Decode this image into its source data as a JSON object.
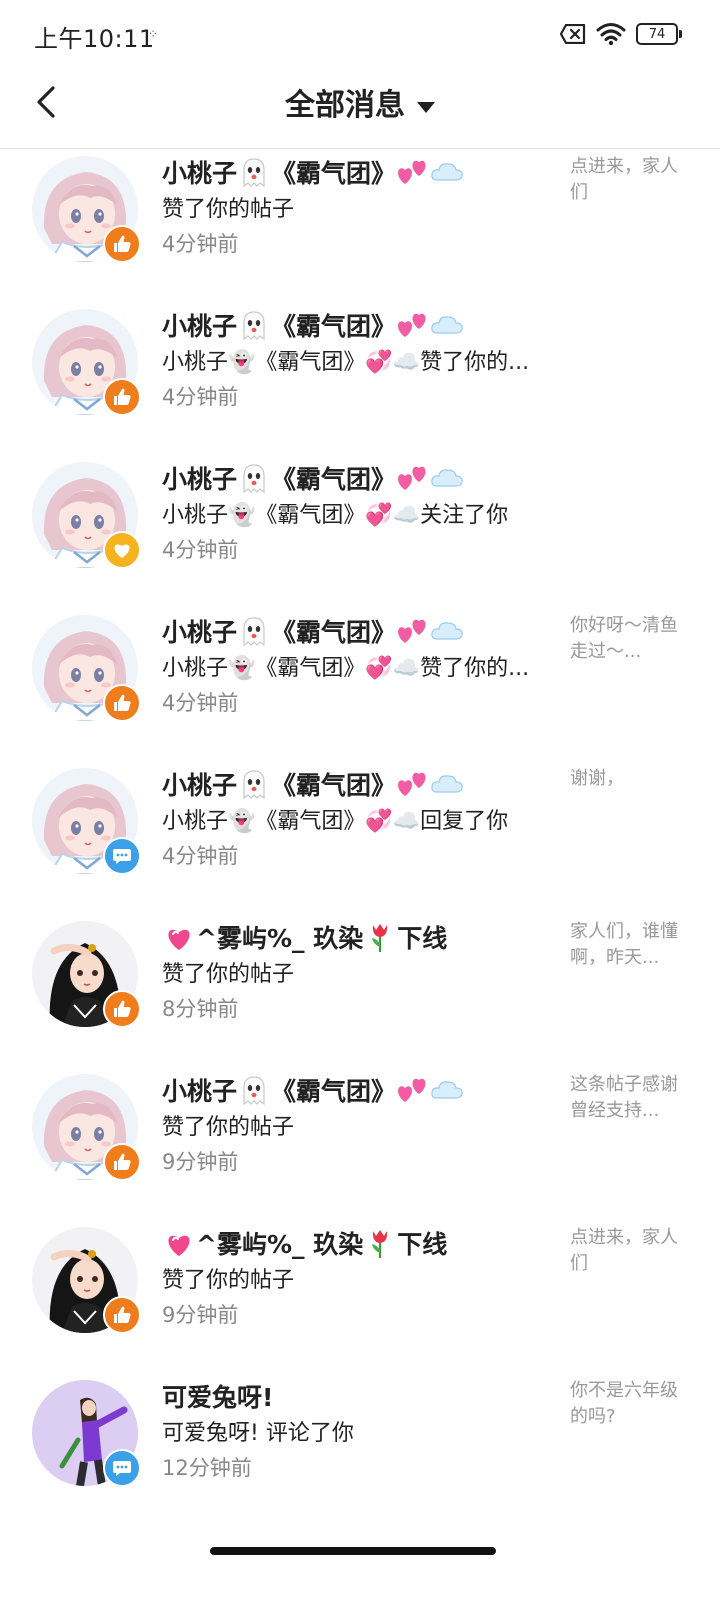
{
  "status_bar": {
    "time": "上午10:11",
    "battery": "74"
  },
  "header": {
    "title": "全部消息"
  },
  "messages": [
    {
      "name": "小桃子",
      "name_mid": "《霸气团》",
      "action": "赞了你的帖子",
      "time": "4分钟前",
      "preview": "点进来，家人们",
      "badge": "like-icon",
      "avatar": "pink-girl"
    },
    {
      "name": "小桃子",
      "name_mid": "《霸气团》",
      "action": "小桃子👻《霸气团》💞☁️赞了你的...",
      "time": "4分钟前",
      "preview": "",
      "badge": "like-icon",
      "avatar": "pink-girl"
    },
    {
      "name": "小桃子",
      "name_mid": "《霸气团》",
      "action": "小桃子👻《霸气团》💞☁️关注了你",
      "time": "4分钟前",
      "preview": "",
      "badge": "heart-icon",
      "avatar": "pink-girl"
    },
    {
      "name": "小桃子",
      "name_mid": "《霸气团》",
      "action": "小桃子👻《霸气团》💞☁️赞了你的...",
      "time": "4分钟前",
      "preview": "你好呀～清鱼走过～...",
      "badge": "like-icon",
      "avatar": "pink-girl"
    },
    {
      "name": "小桃子",
      "name_mid": "《霸气团》",
      "action": "小桃子👻《霸气团》💞☁️回复了你",
      "time": "4分钟前",
      "preview": "谢谢，",
      "badge": "comment-icon",
      "avatar": "pink-girl"
    },
    {
      "name": "^雾屿%_ 玖染",
      "name_suffix": "下线",
      "action": "赞了你的帖子",
      "time": "8分钟前",
      "preview": "家人们，谁懂啊，昨天...",
      "badge": "like-icon",
      "avatar": "dark-girl"
    },
    {
      "name": "小桃子",
      "name_mid": "《霸气团》",
      "action": "赞了你的帖子",
      "time": "9分钟前",
      "preview": "这条帖子感谢曾经支持...",
      "badge": "like-icon",
      "avatar": "pink-girl"
    },
    {
      "name": "^雾屿%_ 玖染",
      "name_suffix": "下线",
      "action": "赞了你的帖子",
      "time": "9分钟前",
      "preview": "点进来，家人们",
      "badge": "like-icon",
      "avatar": "dark-girl"
    },
    {
      "name": "可爱兔呀!",
      "action": "可爱兔呀! 评论了你",
      "time": "12分钟前",
      "preview": "你不是六年级的吗?",
      "badge": "comment-icon",
      "avatar": "purple-girl"
    }
  ],
  "colors": {
    "like": "#f07d1c",
    "follow": "#f5b41f",
    "comment": "#3aa0e8",
    "time": "#888888",
    "preview": "#999999"
  }
}
